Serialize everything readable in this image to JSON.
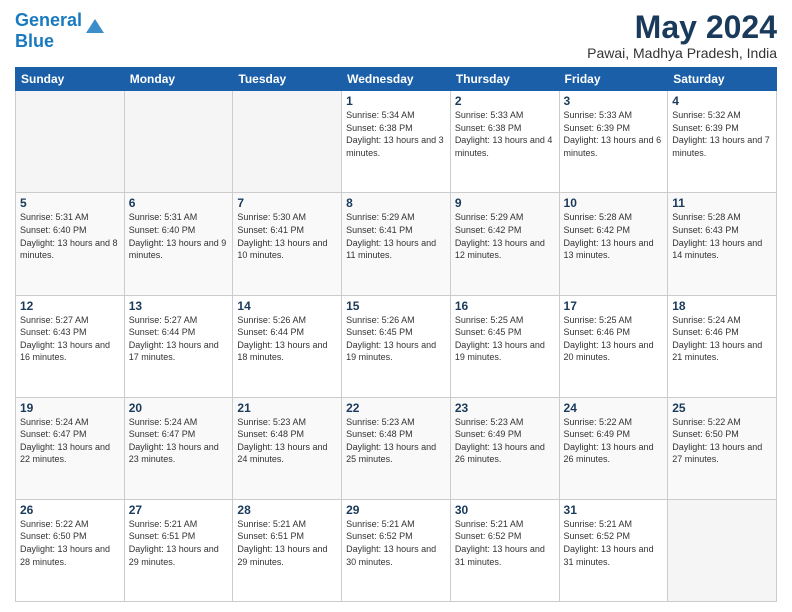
{
  "header": {
    "logo_line1": "General",
    "logo_line2": "Blue",
    "title": "May 2024",
    "subtitle": "Pawai, Madhya Pradesh, India"
  },
  "weekdays": [
    "Sunday",
    "Monday",
    "Tuesday",
    "Wednesday",
    "Thursday",
    "Friday",
    "Saturday"
  ],
  "weeks": [
    [
      {
        "day": "",
        "detail": ""
      },
      {
        "day": "",
        "detail": ""
      },
      {
        "day": "",
        "detail": ""
      },
      {
        "day": "1",
        "detail": "Sunrise: 5:34 AM\nSunset: 6:38 PM\nDaylight: 13 hours and 3 minutes."
      },
      {
        "day": "2",
        "detail": "Sunrise: 5:33 AM\nSunset: 6:38 PM\nDaylight: 13 hours and 4 minutes."
      },
      {
        "day": "3",
        "detail": "Sunrise: 5:33 AM\nSunset: 6:39 PM\nDaylight: 13 hours and 6 minutes."
      },
      {
        "day": "4",
        "detail": "Sunrise: 5:32 AM\nSunset: 6:39 PM\nDaylight: 13 hours and 7 minutes."
      }
    ],
    [
      {
        "day": "5",
        "detail": "Sunrise: 5:31 AM\nSunset: 6:40 PM\nDaylight: 13 hours and 8 minutes."
      },
      {
        "day": "6",
        "detail": "Sunrise: 5:31 AM\nSunset: 6:40 PM\nDaylight: 13 hours and 9 minutes."
      },
      {
        "day": "7",
        "detail": "Sunrise: 5:30 AM\nSunset: 6:41 PM\nDaylight: 13 hours and 10 minutes."
      },
      {
        "day": "8",
        "detail": "Sunrise: 5:29 AM\nSunset: 6:41 PM\nDaylight: 13 hours and 11 minutes."
      },
      {
        "day": "9",
        "detail": "Sunrise: 5:29 AM\nSunset: 6:42 PM\nDaylight: 13 hours and 12 minutes."
      },
      {
        "day": "10",
        "detail": "Sunrise: 5:28 AM\nSunset: 6:42 PM\nDaylight: 13 hours and 13 minutes."
      },
      {
        "day": "11",
        "detail": "Sunrise: 5:28 AM\nSunset: 6:43 PM\nDaylight: 13 hours and 14 minutes."
      }
    ],
    [
      {
        "day": "12",
        "detail": "Sunrise: 5:27 AM\nSunset: 6:43 PM\nDaylight: 13 hours and 16 minutes."
      },
      {
        "day": "13",
        "detail": "Sunrise: 5:27 AM\nSunset: 6:44 PM\nDaylight: 13 hours and 17 minutes."
      },
      {
        "day": "14",
        "detail": "Sunrise: 5:26 AM\nSunset: 6:44 PM\nDaylight: 13 hours and 18 minutes."
      },
      {
        "day": "15",
        "detail": "Sunrise: 5:26 AM\nSunset: 6:45 PM\nDaylight: 13 hours and 19 minutes."
      },
      {
        "day": "16",
        "detail": "Sunrise: 5:25 AM\nSunset: 6:45 PM\nDaylight: 13 hours and 19 minutes."
      },
      {
        "day": "17",
        "detail": "Sunrise: 5:25 AM\nSunset: 6:46 PM\nDaylight: 13 hours and 20 minutes."
      },
      {
        "day": "18",
        "detail": "Sunrise: 5:24 AM\nSunset: 6:46 PM\nDaylight: 13 hours and 21 minutes."
      }
    ],
    [
      {
        "day": "19",
        "detail": "Sunrise: 5:24 AM\nSunset: 6:47 PM\nDaylight: 13 hours and 22 minutes."
      },
      {
        "day": "20",
        "detail": "Sunrise: 5:24 AM\nSunset: 6:47 PM\nDaylight: 13 hours and 23 minutes."
      },
      {
        "day": "21",
        "detail": "Sunrise: 5:23 AM\nSunset: 6:48 PM\nDaylight: 13 hours and 24 minutes."
      },
      {
        "day": "22",
        "detail": "Sunrise: 5:23 AM\nSunset: 6:48 PM\nDaylight: 13 hours and 25 minutes."
      },
      {
        "day": "23",
        "detail": "Sunrise: 5:23 AM\nSunset: 6:49 PM\nDaylight: 13 hours and 26 minutes."
      },
      {
        "day": "24",
        "detail": "Sunrise: 5:22 AM\nSunset: 6:49 PM\nDaylight: 13 hours and 26 minutes."
      },
      {
        "day": "25",
        "detail": "Sunrise: 5:22 AM\nSunset: 6:50 PM\nDaylight: 13 hours and 27 minutes."
      }
    ],
    [
      {
        "day": "26",
        "detail": "Sunrise: 5:22 AM\nSunset: 6:50 PM\nDaylight: 13 hours and 28 minutes."
      },
      {
        "day": "27",
        "detail": "Sunrise: 5:21 AM\nSunset: 6:51 PM\nDaylight: 13 hours and 29 minutes."
      },
      {
        "day": "28",
        "detail": "Sunrise: 5:21 AM\nSunset: 6:51 PM\nDaylight: 13 hours and 29 minutes."
      },
      {
        "day": "29",
        "detail": "Sunrise: 5:21 AM\nSunset: 6:52 PM\nDaylight: 13 hours and 30 minutes."
      },
      {
        "day": "30",
        "detail": "Sunrise: 5:21 AM\nSunset: 6:52 PM\nDaylight: 13 hours and 31 minutes."
      },
      {
        "day": "31",
        "detail": "Sunrise: 5:21 AM\nSunset: 6:52 PM\nDaylight: 13 hours and 31 minutes."
      },
      {
        "day": "",
        "detail": ""
      }
    ]
  ]
}
